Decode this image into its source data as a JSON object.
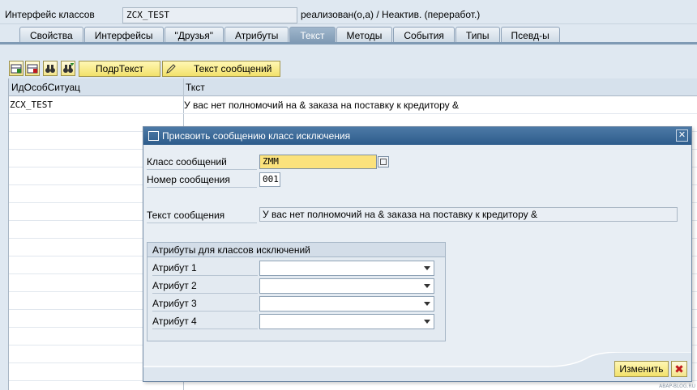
{
  "header": {
    "label": "Интерфейс классов",
    "class_name": "ZCX_TEST",
    "status": "реализован(о,а) / Неактив. (переработ.)"
  },
  "tabs": [
    {
      "label": "Свойства"
    },
    {
      "label": "Интерфейсы"
    },
    {
      "label": "\"Друзья\""
    },
    {
      "label": "Атрибуты"
    },
    {
      "label": "Текст"
    },
    {
      "label": "Методы"
    },
    {
      "label": "События"
    },
    {
      "label": "Типы"
    },
    {
      "label": "Псевд-ы"
    }
  ],
  "active_tab": "Текст",
  "toolbar": {
    "long_text_label": "ПодрТекст",
    "message_text_label": "Текст сообщений"
  },
  "table": {
    "columns": [
      "ИдОсобСитуац",
      "Ткст"
    ],
    "rows": [
      [
        "ZCX_TEST",
        "У вас нет полномочий на & заказа на поставку к кредитору &"
      ]
    ]
  },
  "dialog": {
    "title": "Присвоить сообщению класс исключения",
    "message_class_label": "Класс сообщений",
    "message_class_value": "ZMM",
    "message_number_label": "Номер сообщения",
    "message_number_value": "001",
    "message_text_label": "Текст сообщения",
    "message_text_value": "У вас нет полномочий на & заказа на поставку к кредитору &",
    "group_title": "Атрибуты для классов исключений",
    "attributes": [
      {
        "label": "Атрибут 1",
        "value": ""
      },
      {
        "label": "Атрибут 2",
        "value": ""
      },
      {
        "label": "Атрибут 3",
        "value": ""
      },
      {
        "label": "Атрибут 4",
        "value": ""
      }
    ],
    "change_button": "Изменить",
    "cancel_icon": "cancel-x-icon"
  },
  "watermark": "ABAP-BLOG.RU",
  "colors": {
    "title_bar": "#2d5c8b",
    "button_yellow": "#f2e16a",
    "highlight_field": "#fbe27c",
    "cancel_red": "#c0191e",
    "background": "#dfe8f1"
  }
}
